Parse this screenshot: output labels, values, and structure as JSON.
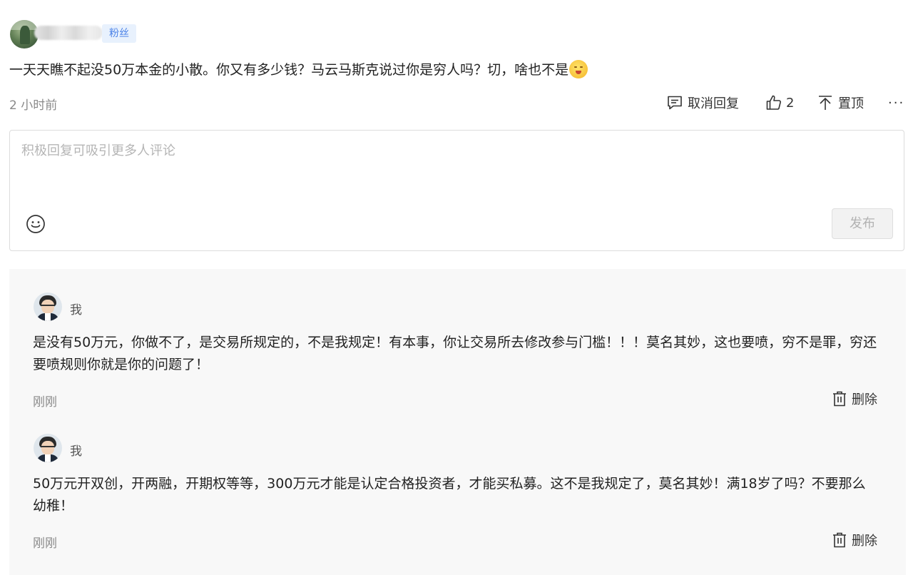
{
  "comment": {
    "badge": "粉丝",
    "text": "一天天瞧不起没50万本金的小散。你又有多少钱？马云马斯克说过你是穷人吗？切，啥也不是",
    "emoji": "flushed-face-emoji",
    "time": "2 小时前",
    "actions": {
      "cancel_reply": "取消回复",
      "like_count": "2",
      "pin": "置顶",
      "more": "···"
    }
  },
  "reply_box": {
    "placeholder": "积极回复可吸引更多人评论",
    "publish": "发布"
  },
  "replies": [
    {
      "name": "我",
      "text": "是没有50万元，你做不了，是交易所规定的，不是我规定！有本事，你让交易所去修改参与门槛！！！莫名其妙，这也要喷，穷不是罪，穷还要喷规则你就是你的问题了！",
      "time": "刚刚",
      "delete": "删除"
    },
    {
      "name": "我",
      "text": "50万元开双创，开两融，开期权等等，300万元才能是认定合格投资者，才能买私募。这不是我规定了，莫名其妙！满18岁了吗？不要那么幼稚！",
      "time": "刚刚",
      "delete": "删除"
    }
  ],
  "colors": {
    "badge_bg": "#e8f1fd",
    "badge_text": "#4b82e8",
    "panel_bg": "#f8f8f8",
    "muted": "#8a8a8a"
  }
}
